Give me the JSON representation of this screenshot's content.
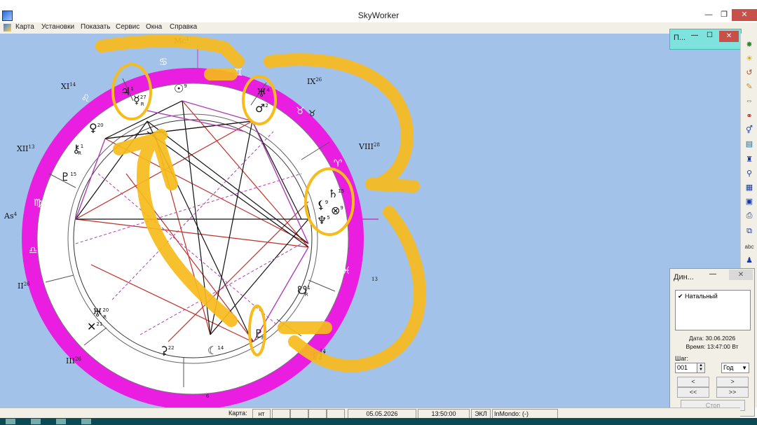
{
  "window": {
    "title": "SkyWorker",
    "min_glyph": "—",
    "max_glyph": "❐",
    "close_glyph": "✕"
  },
  "menu": {
    "items": [
      "Карта",
      "Установки",
      "Показать",
      "Сервис",
      "Окна",
      "Справка"
    ]
  },
  "mini_window": {
    "title": "П...",
    "min_glyph": "—",
    "max_glyph": "☐",
    "close_glyph": "✕"
  },
  "dynamics_panel": {
    "title": "Дин...",
    "list_item": "✔ Натальный",
    "date_label": "Дата: 30.06.2026",
    "time_label": "Время: 13:47:00 Вт",
    "step_label": "Шаг:",
    "step_value": "001",
    "step_unit": "Год",
    "btn_back": "<",
    "btn_forward": ">",
    "btn_fast_back": "<<",
    "btn_fast_forward": ">>",
    "btn_stop": "Стоп"
  },
  "status_bar": {
    "label": "Карта:",
    "map_type": "нт",
    "date": "05.05.2026",
    "time": "13:50:00",
    "coords": "ЭКЛ",
    "place": "InMondo: (-)"
  },
  "chart": {
    "zodiac_signs": [
      {
        "name": "cancer",
        "glyph": "♋"
      },
      {
        "name": "leo",
        "glyph": "♌"
      },
      {
        "name": "virgo",
        "glyph": "♍"
      },
      {
        "name": "libra",
        "glyph": "♎"
      },
      {
        "name": "scorpio",
        "glyph": "♏"
      },
      {
        "name": "sagittarius",
        "glyph": "♐"
      },
      {
        "name": "capricorn",
        "glyph": "♑"
      },
      {
        "name": "aquarius",
        "glyph": "♒"
      },
      {
        "name": "pisces",
        "glyph": "♓"
      },
      {
        "name": "aries",
        "glyph": "♈"
      },
      {
        "name": "taurus",
        "glyph": "♉"
      },
      {
        "name": "gemini",
        "glyph": "♊"
      }
    ],
    "house_labels": [
      {
        "name": "mc",
        "text": "Mc",
        "degree": "1"
      },
      {
        "name": "house-9",
        "text": "IX",
        "degree": "26"
      },
      {
        "name": "house-8",
        "text": "VIII",
        "degree": "28"
      },
      {
        "name": "house-11",
        "text": "XI",
        "degree": "14"
      },
      {
        "name": "house-12",
        "text": "XII",
        "degree": "13"
      },
      {
        "name": "asc",
        "text": "As",
        "degree": "4"
      },
      {
        "name": "house-2",
        "text": "II",
        "degree": "26"
      },
      {
        "name": "house-3",
        "text": "III",
        "degree": "26"
      },
      {
        "name": "house-5-degree",
        "text": "",
        "degree": "6"
      },
      {
        "name": "house-6-degree",
        "text": "",
        "degree": "14"
      },
      {
        "name": "house-7-degree",
        "text": "",
        "degree": "13"
      }
    ],
    "planets": [
      {
        "name": "jupiter",
        "glyph": "♃",
        "degree": "1",
        "retro": ""
      },
      {
        "name": "mercury",
        "glyph": "☿",
        "degree": "27",
        "retro": "R"
      },
      {
        "name": "sun",
        "glyph": "☉",
        "degree": "9",
        "retro": ""
      },
      {
        "name": "uranus",
        "glyph": "♅",
        "degree": "4",
        "retro": ""
      },
      {
        "name": "mars",
        "glyph": "♂",
        "degree": "2",
        "retro": ""
      },
      {
        "name": "venus",
        "glyph": "♀",
        "degree": "20",
        "retro": ""
      },
      {
        "name": "chiron",
        "glyph": "⚷",
        "degree": "1",
        "retro": "R"
      },
      {
        "name": "proserpina",
        "glyph": "♇",
        "degree": "15",
        "retro": ""
      },
      {
        "name": "saturn",
        "glyph": "♄",
        "degree": "15",
        "retro": ""
      },
      {
        "name": "lilith",
        "glyph": "⚸",
        "degree": "9",
        "retro": ""
      },
      {
        "name": "fortune",
        "glyph": "⊗",
        "degree": "9",
        "retro": ""
      },
      {
        "name": "neptune",
        "glyph": "♆",
        "degree": "5",
        "retro": ""
      },
      {
        "name": "node-south",
        "glyph": "☋",
        "degree": "1",
        "retro": "R"
      },
      {
        "name": "pluto",
        "glyph": "♇",
        "degree": "5",
        "retro": "R"
      },
      {
        "name": "moon",
        "glyph": "☾",
        "degree": "14",
        "retro": ""
      },
      {
        "name": "ceres",
        "glyph": "⚳",
        "degree": "22",
        "retro": ""
      },
      {
        "name": "node-north",
        "glyph": "☊",
        "degree": "1",
        "retro": ""
      },
      {
        "name": "herschel",
        "glyph": "♅",
        "degree": "20",
        "retro": "R"
      },
      {
        "name": "cross-point",
        "glyph": "✕",
        "degree": "21",
        "retro": ""
      },
      {
        "name": "mercury-sign",
        "glyph": "♉",
        "degree": "",
        "retro": ""
      }
    ]
  },
  "toolbar_icons": [
    "bug-icon",
    "sun-icon",
    "undo-icon",
    "pencil-icon",
    "scale-icon",
    "rings-icon",
    "gender-icon",
    "ruler-icon",
    "runner-icon",
    "magnifier-icon",
    "document-icon",
    "calendar-icon",
    "printer-icon",
    "export-icon",
    "abc-icon",
    "figure-icon"
  ],
  "colors": {
    "workspace": "#a3c2ea",
    "zodiac_ring": "#e91ee1",
    "annotation": "#f7bb1c",
    "aspect_red": "#c0302a",
    "aspect_black": "#111111",
    "aspect_purple": "#b03cb8"
  }
}
